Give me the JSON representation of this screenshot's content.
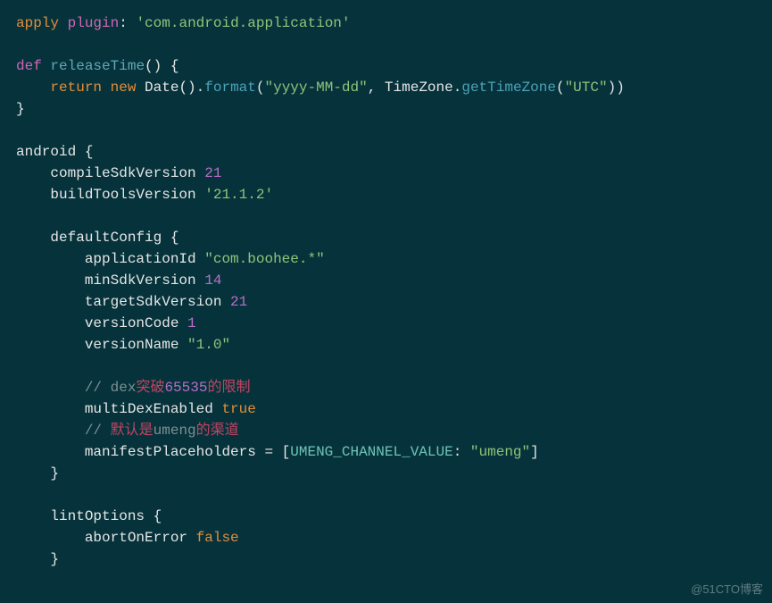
{
  "code": {
    "l1": {
      "apply": "apply",
      "plugin": "plugin",
      "colon": ":",
      "val": "'com.android.application'"
    },
    "l2": {
      "def": "def",
      "name": "releaseTime",
      "parens": "()",
      "brace": "{"
    },
    "l3": {
      "ret": "return",
      "new": "new",
      "date": "Date",
      "parens": "()",
      "dot1": ".",
      "format": "format",
      "open": "(",
      "fmt": "\"yyyy-MM-dd\"",
      "comma": ",",
      "tz": "TimeZone",
      "dot2": ".",
      "get": "getTimeZone",
      "open2": "(",
      "utc": "\"UTC\"",
      "close": "))"
    },
    "l4": {
      "brace": "}"
    },
    "l5": {
      "android": "android",
      "brace": "{"
    },
    "l6": {
      "prop": "compileSdkVersion",
      "val": "21"
    },
    "l7": {
      "prop": "buildToolsVersion",
      "val": "'21.1.2'"
    },
    "l8": {
      "prop": "defaultConfig",
      "brace": "{"
    },
    "l9": {
      "prop": "applicationId",
      "val": "\"com.boohee.*\""
    },
    "l10": {
      "prop": "minSdkVersion",
      "val": "14"
    },
    "l11": {
      "prop": "targetSdkVersion",
      "val": "21"
    },
    "l12": {
      "prop": "versionCode",
      "val": "1"
    },
    "l13": {
      "prop": "versionName",
      "val": "\"1.0\""
    },
    "l14": {
      "slash": "//",
      "sp": " ",
      "dex": "dex",
      "cjk1": "突破",
      "num": "65535",
      "cjk2": "的限制"
    },
    "l15": {
      "prop": "multiDexEnabled",
      "val": "true"
    },
    "l16": {
      "slash": "//",
      "sp": " ",
      "cjk1": "默认是",
      "umeng": "umeng",
      "cjk2": "的渠道"
    },
    "l17": {
      "prop": "manifestPlaceholders",
      "eq": " = ",
      "open": "[",
      "key": "UMENG_CHANNEL_VALUE",
      "colon": ":",
      "sp": " ",
      "val": "\"umeng\"",
      "close": "]"
    },
    "l18": {
      "brace": "}"
    },
    "l19": {
      "prop": "lintOptions",
      "brace": "{"
    },
    "l20": {
      "prop": "abortOnError",
      "val": "false"
    },
    "l21": {
      "brace": "}"
    }
  },
  "watermark": "@51CTO博客"
}
